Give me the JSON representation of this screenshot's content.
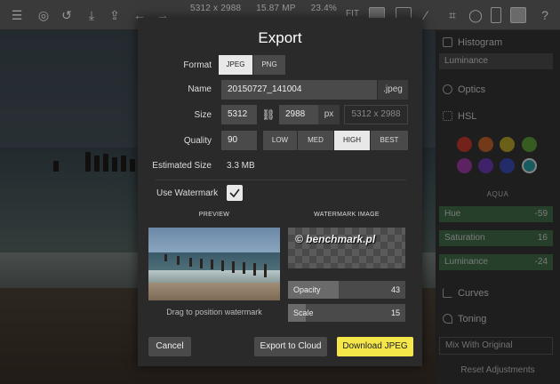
{
  "toolbar": {
    "dimensions": "5312 x 2988",
    "megapixels": "15.87 MP",
    "zoom": "23.4%",
    "fit_label": "FIT"
  },
  "right_panel": {
    "luminance_top": "Luminance",
    "histogram": "Histogram",
    "optics": "Optics",
    "hsl": "HSL",
    "selected_color_name": "AQUA",
    "hsl_colors": [
      "#c0392b",
      "#c0622b",
      "#b5a12b",
      "#5a9a3a",
      "#9b3aa0",
      "#6a3ab0",
      "#3a4ab0",
      "#2a9aa0"
    ],
    "hue": {
      "label": "Hue",
      "value": "-59"
    },
    "saturation": {
      "label": "Saturation",
      "value": "16"
    },
    "luminance": {
      "label": "Luminance",
      "value": "-24"
    },
    "curves": "Curves",
    "toning": "Toning",
    "mix_with_original": "Mix With Original",
    "reset": "Reset Adjustments"
  },
  "export": {
    "title": "Export",
    "format_label": "Format",
    "format_options": [
      "JPEG",
      "PNG"
    ],
    "format_selected": "JPEG",
    "name_label": "Name",
    "name_value": "20150727_141004",
    "name_ext": ".jpeg",
    "size_label": "Size",
    "width": "5312",
    "height": "2988",
    "size_unit": "px",
    "size_display": "5312 x 2988",
    "quality_label": "Quality",
    "quality_value": "90",
    "quality_options": [
      "LOW",
      "MED",
      "HIGH",
      "BEST"
    ],
    "quality_selected": "HIGH",
    "estimated_label": "Estimated Size",
    "estimated_value": "3.3 MB",
    "watermark_label": "Use Watermark",
    "watermark_checked": true,
    "preview_head": "PREVIEW",
    "watermark_image_head": "WATERMARK IMAGE",
    "watermark_text": "© benchmark.pl",
    "drag_caption": "Drag to position watermark",
    "opacity": {
      "label": "Opacity",
      "value": "43"
    },
    "scale": {
      "label": "Scale",
      "value": "15"
    },
    "cancel": "Cancel",
    "export_cloud": "Export to Cloud",
    "download": "Download JPEG"
  }
}
